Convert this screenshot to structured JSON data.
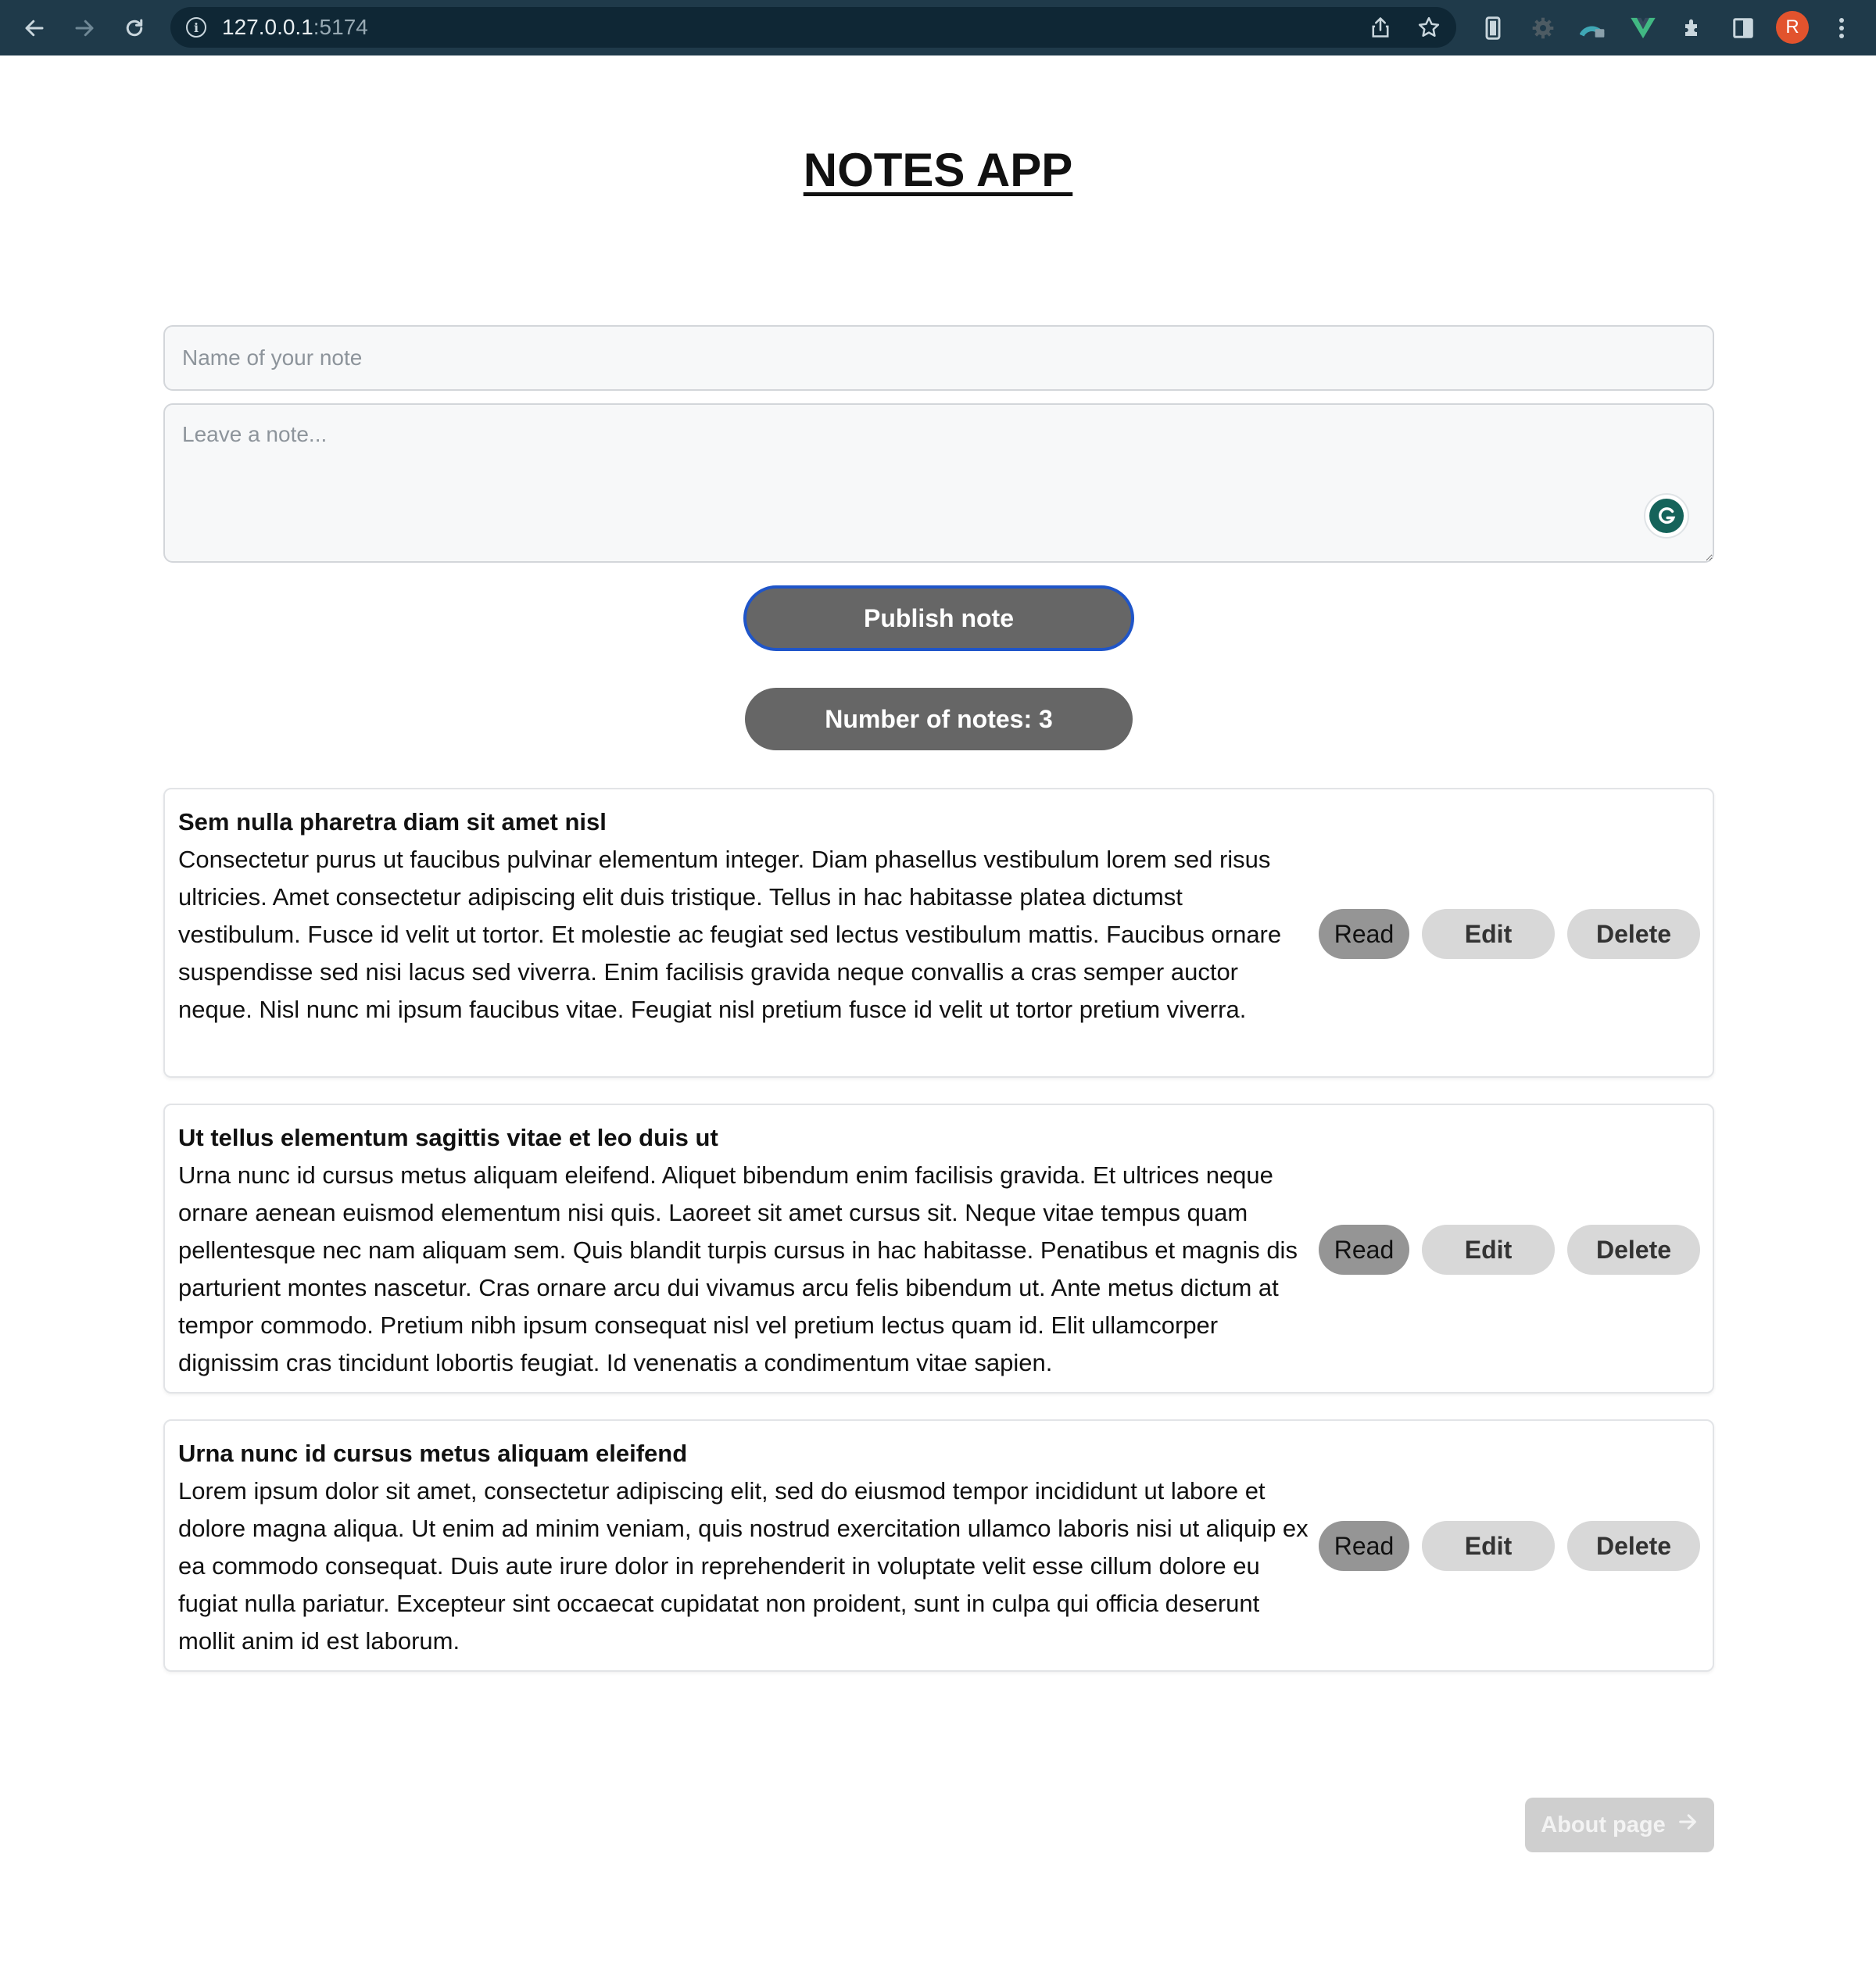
{
  "browser": {
    "url_host": "127.0.0.1",
    "url_port": ":5174",
    "avatar_initial": "R",
    "icons": [
      "back-icon",
      "forward-icon",
      "reload-icon",
      "info-icon",
      "share-icon",
      "bookmark-star-icon",
      "device-icon",
      "extension-gear-icon",
      "extension-lock-icon",
      "vue-devtools-icon",
      "puzzle-extensions-icon",
      "side-panel-icon",
      "more-menu-icon"
    ]
  },
  "app": {
    "title": "NOTES APP",
    "name_placeholder": "Name of your note",
    "note_placeholder": "Leave a note...",
    "publish_label": "Publish note",
    "count_label": "Number of notes: 3",
    "accent_color": "#1f55c9",
    "button_color": "#666666"
  },
  "notes": [
    {
      "title": "Sem nulla pharetra diam sit amet nisl",
      "body": "Consectetur purus ut faucibus pulvinar elementum integer. Diam phasellus vestibulum lorem sed risus ultricies. Amet consectetur adipiscing elit duis tristique. Tellus in hac habitasse platea dictumst vestibulum. Fusce id velit ut tortor. Et molestie ac feugiat sed lectus vestibulum mattis. Faucibus ornare suspendisse sed nisi lacus sed viverra. Enim facilisis gravida neque convallis a cras semper auctor neque. Nisl nunc mi ipsum faucibus vitae. Feugiat nisl pretium fusce id velit ut tortor pretium viverra.",
      "read_label": "Read",
      "edit_label": "Edit",
      "delete_label": "Delete"
    },
    {
      "title": "Ut tellus elementum sagittis vitae et leo duis ut",
      "body": "Urna nunc id cursus metus aliquam eleifend. Aliquet bibendum enim facilisis gravida. Et ultrices neque ornare aenean euismod elementum nisi quis. Laoreet sit amet cursus sit. Neque vitae tempus quam pellentesque nec nam aliquam sem. Quis blandit turpis cursus in hac habitasse. Penatibus et magnis dis parturient montes nascetur. Cras ornare arcu dui vivamus arcu felis bibendum ut. Ante metus dictum at tempor commodo. Pretium nibh ipsum consequat nisl vel pretium lectus quam id. Elit ullamcorper dignissim cras tincidunt lobortis feugiat. Id venenatis a condimentum vitae sapien.",
      "read_label": "Read",
      "edit_label": "Edit",
      "delete_label": "Delete"
    },
    {
      "title": "Urna nunc id cursus metus aliquam eleifend",
      "body": "Lorem ipsum dolor sit amet, consectetur adipiscing elit, sed do eiusmod tempor incididunt ut labore et dolore magna aliqua. Ut enim ad minim veniam, quis nostrud exercitation ullamco laboris nisi ut aliquip ex ea commodo consequat. Duis aute irure dolor in reprehenderit in voluptate velit esse cillum dolore eu fugiat nulla pariatur. Excepteur sint occaecat cupidatat non proident, sunt in culpa qui officia deserunt mollit anim id est laborum.",
      "read_label": "Read",
      "edit_label": "Edit",
      "delete_label": "Delete"
    }
  ],
  "footer": {
    "about_label": "About page"
  }
}
